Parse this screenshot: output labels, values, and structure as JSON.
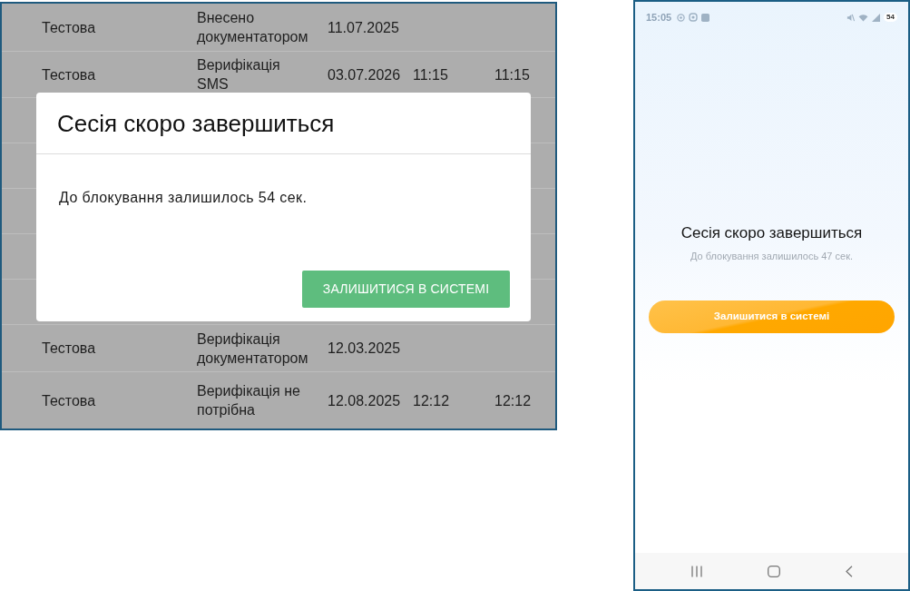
{
  "desktop_view": {
    "table": {
      "rows": [
        {
          "column_1": "Тестова",
          "column_2": "Внесено документатором",
          "column_3": "11.07.2025"
        },
        {
          "column_1": "Тестова",
          "column_2": "Верифікація SMS",
          "column_3": "03.07.2026",
          "column_4": "11:15",
          "column_5": "11:15"
        },
        {
          "column_1": "Тестова",
          "column_2": "Верифікація документатором",
          "column_3": "12.03.2025"
        },
        {
          "column_1": "Тестова",
          "column_2": "Верифікація не потрібна",
          "column_3": "12.08.2025",
          "column_4": "12:12",
          "column_5": "12:12"
        }
      ]
    },
    "dialog": {
      "title": "Сесія скоро завершиться",
      "message": "До блокування залишилось 54 сек.",
      "button": "ЗАЛИШИТИСЯ В СИСТЕМІ"
    }
  },
  "mobile_view": {
    "status_bar": {
      "time": "15:05",
      "battery": "54"
    },
    "dialog": {
      "title": "Сесія скоро завершиться",
      "message": "До блокування залишилось 47 сек.",
      "button": "Залишитися в системі"
    }
  }
}
